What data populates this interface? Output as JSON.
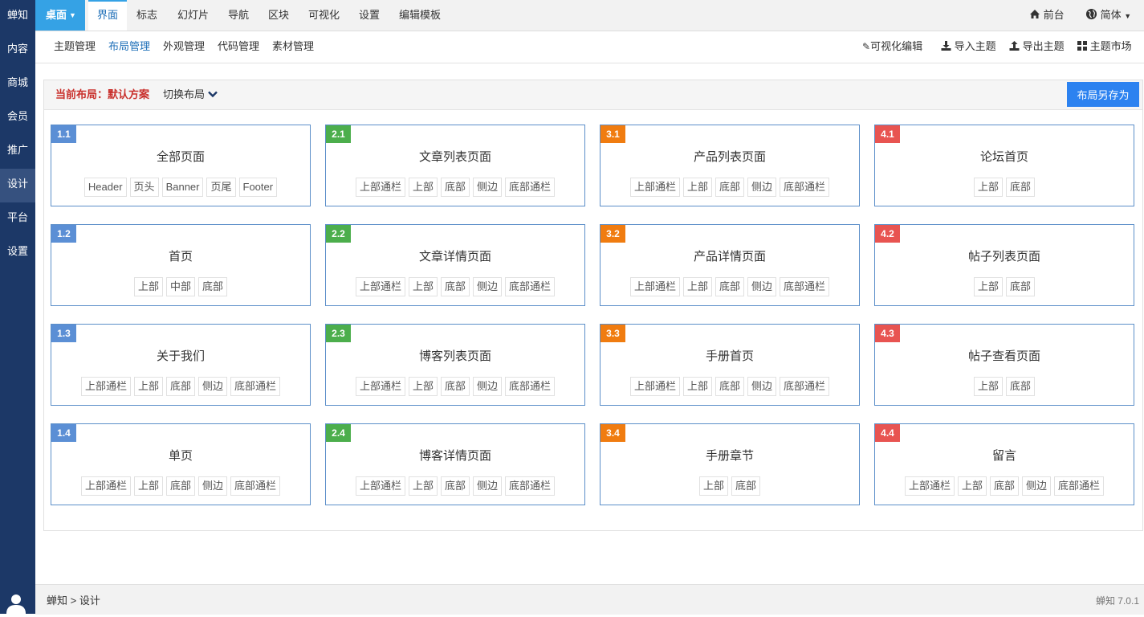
{
  "sidebar": {
    "items": [
      "蝉知",
      "内容",
      "商城",
      "会员",
      "推广",
      "设计",
      "平台",
      "设置"
    ],
    "active": "设计"
  },
  "topnav": {
    "desk_label": "桌面",
    "tabs": [
      "界面",
      "标志",
      "幻灯片",
      "导航",
      "区块",
      "可视化",
      "设置",
      "编辑模板"
    ],
    "active_tab": "界面",
    "front_label": "前台",
    "lang_label": "简体"
  },
  "subnav": {
    "items": [
      "主题管理",
      "布局管理",
      "外观管理",
      "代码管理",
      "素材管理"
    ],
    "active": "布局管理",
    "actions": [
      "可视化编辑",
      "导入主题",
      "导出主题",
      "主题市场"
    ]
  },
  "panel": {
    "current_label": "当前布局：默认方案",
    "switch_label": "切换布局",
    "save_as_label": "布局另存为"
  },
  "colors": {
    "c1": "#5b8fd5",
    "c2": "#4cae4c",
    "c3": "#f07c10",
    "c4": "#e85451",
    "sidebar": "#1c3867",
    "accent": "#35a2e5"
  },
  "columns": [
    {
      "color": "#5b8fd5",
      "cards": [
        {
          "num": "1.1",
          "title": "全部页面",
          "tags": [
            "Header",
            "页头",
            "Banner",
            "页尾",
            "Footer"
          ]
        },
        {
          "num": "1.2",
          "title": "首页",
          "tags": [
            "上部",
            "中部",
            "底部"
          ]
        },
        {
          "num": "1.3",
          "title": "关于我们",
          "tags": [
            "上部通栏",
            "上部",
            "底部",
            "侧边",
            "底部通栏"
          ]
        },
        {
          "num": "1.4",
          "title": "单页",
          "tags": [
            "上部通栏",
            "上部",
            "底部",
            "侧边",
            "底部通栏"
          ]
        }
      ]
    },
    {
      "color": "#4cae4c",
      "cards": [
        {
          "num": "2.1",
          "title": "文章列表页面",
          "tags": [
            "上部通栏",
            "上部",
            "底部",
            "侧边",
            "底部通栏"
          ]
        },
        {
          "num": "2.2",
          "title": "文章详情页面",
          "tags": [
            "上部通栏",
            "上部",
            "底部",
            "侧边",
            "底部通栏"
          ]
        },
        {
          "num": "2.3",
          "title": "博客列表页面",
          "tags": [
            "上部通栏",
            "上部",
            "底部",
            "侧边",
            "底部通栏"
          ]
        },
        {
          "num": "2.4",
          "title": "博客详情页面",
          "tags": [
            "上部通栏",
            "上部",
            "底部",
            "侧边",
            "底部通栏"
          ]
        }
      ]
    },
    {
      "color": "#f07c10",
      "cards": [
        {
          "num": "3.1",
          "title": "产品列表页面",
          "tags": [
            "上部通栏",
            "上部",
            "底部",
            "侧边",
            "底部通栏"
          ]
        },
        {
          "num": "3.2",
          "title": "产品详情页面",
          "tags": [
            "上部通栏",
            "上部",
            "底部",
            "侧边",
            "底部通栏"
          ]
        },
        {
          "num": "3.3",
          "title": "手册首页",
          "tags": [
            "上部通栏",
            "上部",
            "底部",
            "侧边",
            "底部通栏"
          ]
        },
        {
          "num": "3.4",
          "title": "手册章节",
          "tags": [
            "上部",
            "底部"
          ]
        }
      ]
    },
    {
      "color": "#e85451",
      "cards": [
        {
          "num": "4.1",
          "title": "论坛首页",
          "tags": [
            "上部",
            "底部"
          ]
        },
        {
          "num": "4.2",
          "title": "帖子列表页面",
          "tags": [
            "上部",
            "底部"
          ]
        },
        {
          "num": "4.3",
          "title": "帖子查看页面",
          "tags": [
            "上部",
            "底部"
          ]
        },
        {
          "num": "4.4",
          "title": "留言",
          "tags": [
            "上部通栏",
            "上部",
            "底部",
            "侧边",
            "底部通栏"
          ]
        }
      ]
    }
  ],
  "footer": {
    "crumb_root": "蝉知",
    "crumb_sep": ">",
    "crumb_current": "设计",
    "version": "蝉知 7.0.1"
  }
}
